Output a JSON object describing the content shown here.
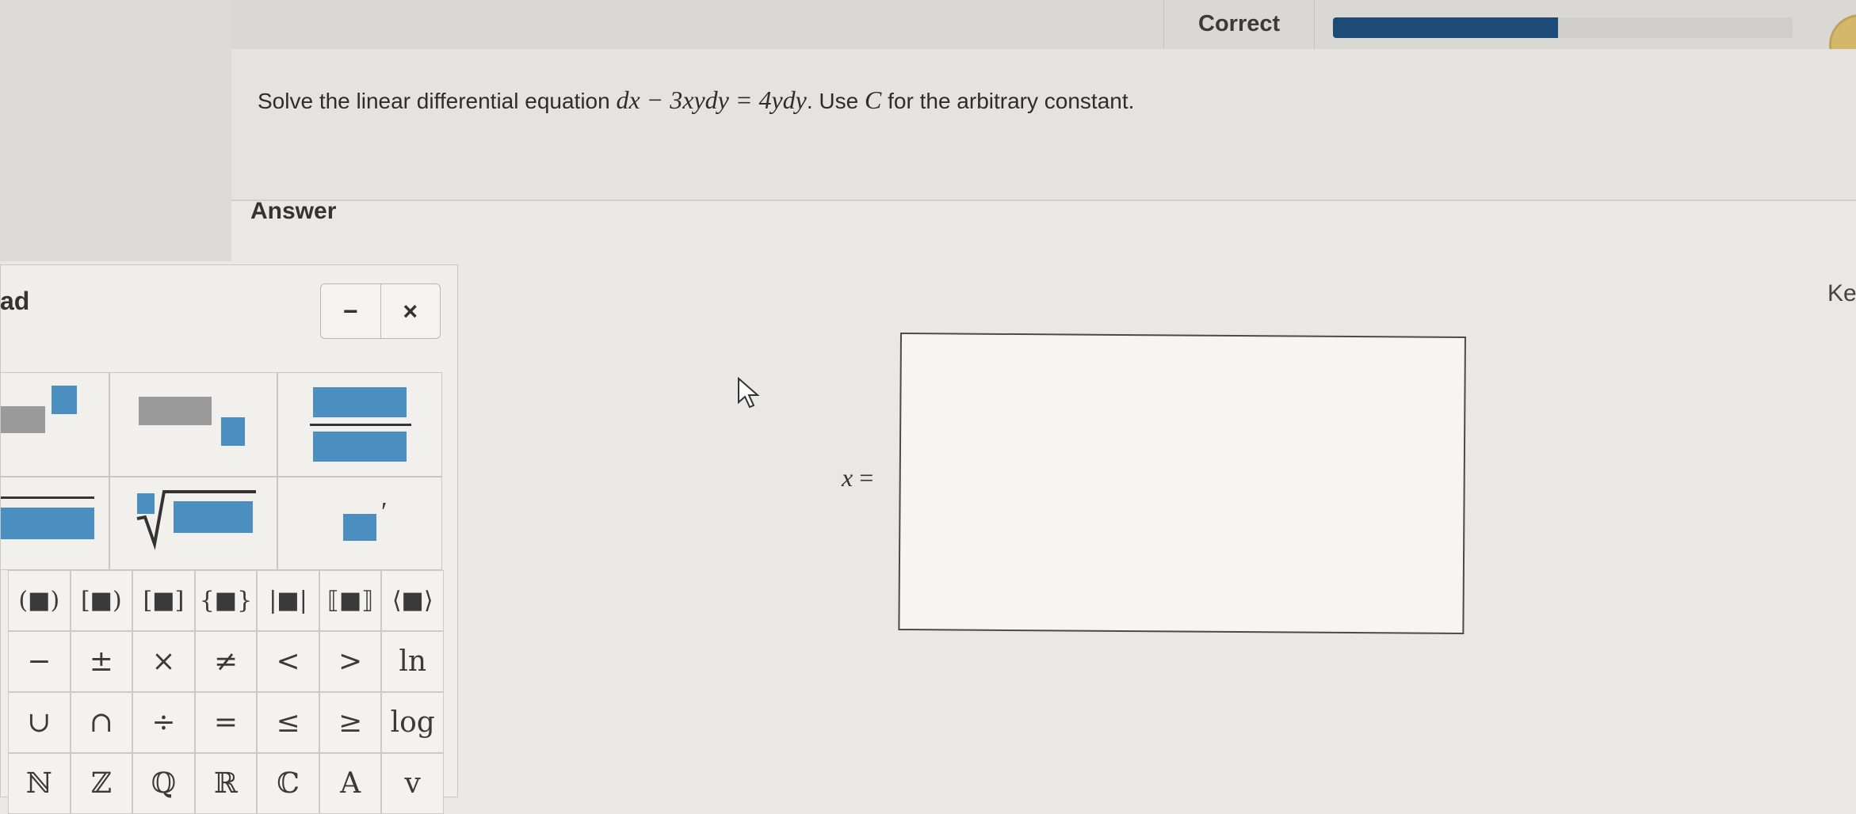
{
  "header": {
    "status_label": "Correct",
    "progress_fraction": 0.49,
    "progress_color": "#1c4b78"
  },
  "question": {
    "prefix": "Solve the linear differential equation",
    "equation": "dx − 3xydy = 4ydy",
    "suffix_before_var": ". Use",
    "constant_var": "C",
    "suffix": "for the arbitrary constant."
  },
  "answer": {
    "heading": "Answer",
    "lhs_var": "x",
    "lhs_eq": "=",
    "input_value": ""
  },
  "keypad": {
    "title_fragment": "ad",
    "right_label_fragment": "Key",
    "minimize_label": "−",
    "close_label": "×",
    "bracket_row": [
      "(■)",
      "[■)",
      "[■]",
      "{■}",
      "|■|",
      "⟦■⟧",
      "⟨■⟩"
    ],
    "symbol_rows": [
      [
        "−",
        "±",
        "×",
        "≠",
        "<",
        ">",
        "ln"
      ],
      [
        "∪",
        "∩",
        "÷",
        "=",
        "≤",
        "≥",
        "log"
      ],
      [
        "ℕ",
        "ℤ",
        "ℚ",
        "ℝ",
        "ℂ",
        "A",
        "v"
      ]
    ],
    "template_color": "#4a8fc0",
    "template_gray": "#9a9a9a"
  }
}
